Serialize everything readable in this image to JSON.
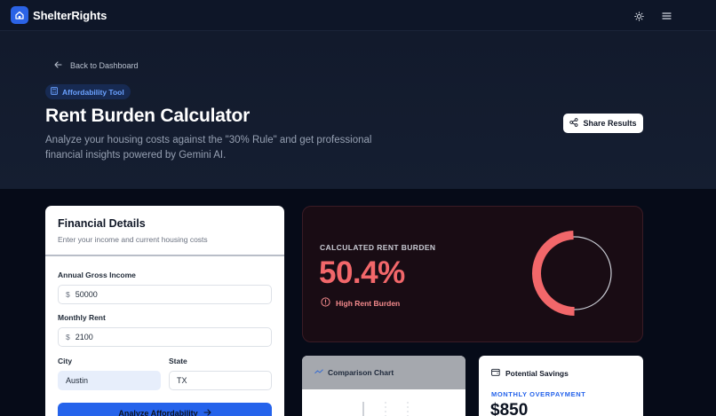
{
  "nav": {
    "brand": "ShelterRights",
    "icons": [
      "home-icon",
      "sun-icon",
      "menu-icon"
    ]
  },
  "hero": {
    "back_label": "Back to Dashboard",
    "badge": "Affordability Tool",
    "title": "Rent Burden Calculator",
    "subtitle": "Analyze your housing costs against the \"30% Rule\" and get professional financial insights powered by Gemini AI.",
    "share_label": "Share Results"
  },
  "form": {
    "title": "Financial Details",
    "description": "Enter your income and current housing costs",
    "income_label": "Annual Gross Income",
    "income_prefix": "$",
    "income_value": "50000",
    "rent_label": "Monthly Rent",
    "rent_prefix": "$",
    "rent_value": "2100",
    "city_label": "City",
    "city_value": "Austin",
    "state_label": "State",
    "state_value": "TX",
    "analyze_label": "Analyze Affordability"
  },
  "result": {
    "label": "CALCULATED RENT BURDEN",
    "value": "50.4%",
    "burden_fraction": 0.504,
    "status": "High Rent Burden",
    "accent_color": "#f2676a"
  },
  "comparison": {
    "title": "Comparison Chart"
  },
  "savings": {
    "title": "Potential Savings",
    "overpay_label": "MONTHLY OVERPAYMENT",
    "overpay_value": "$850"
  },
  "colors": {
    "primary": "#2563eb",
    "danger": "#f2676a",
    "background": "#060b18",
    "hero": "#131b2e"
  }
}
